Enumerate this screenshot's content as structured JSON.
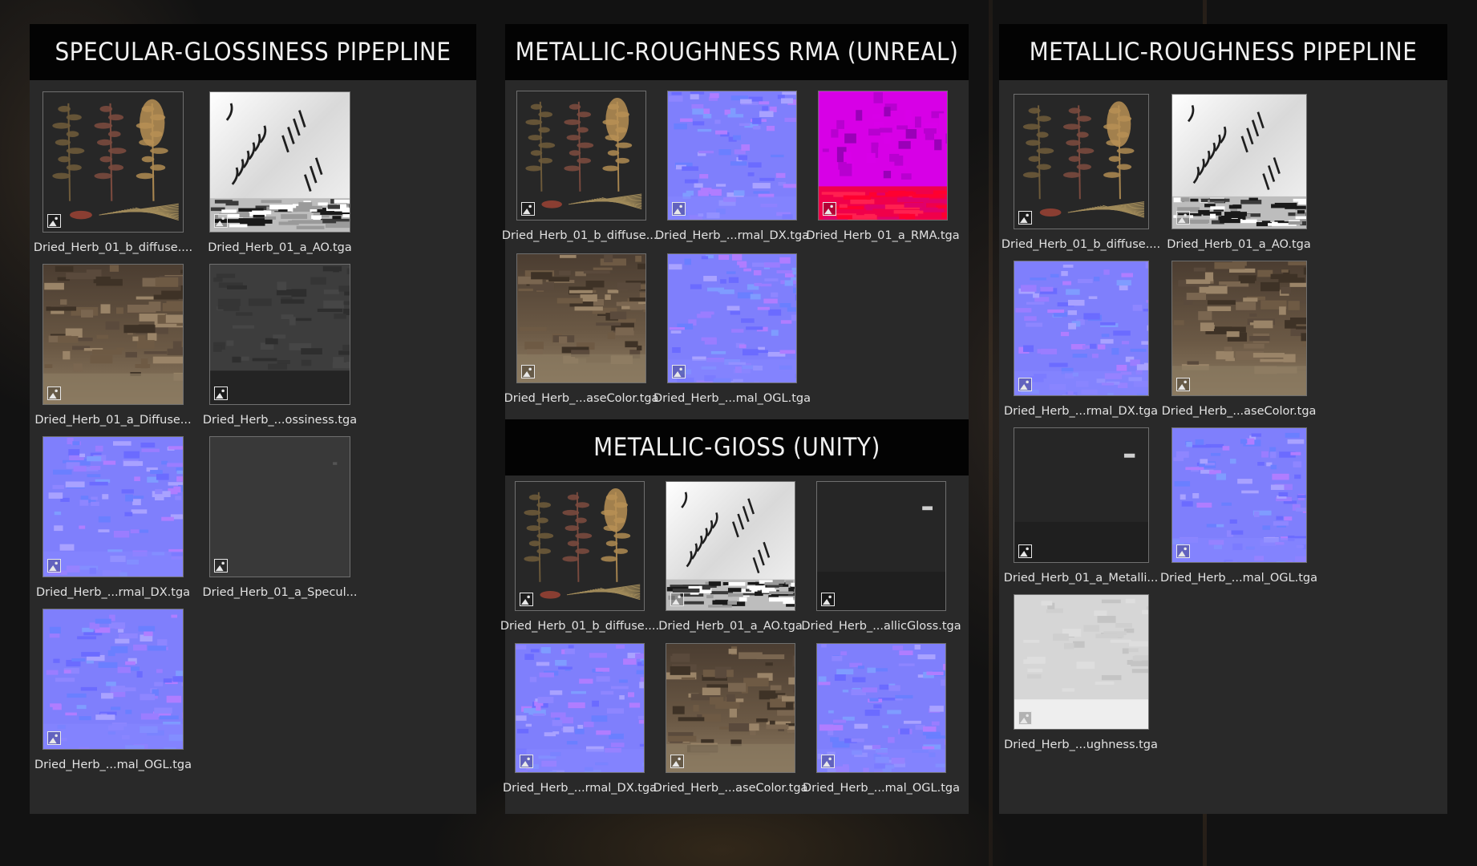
{
  "colors": {
    "panel_bg": "#292929",
    "header_bg": "#030303",
    "header_text": "#f0f0f0",
    "caption_text": "#e2e2e2"
  },
  "panels": {
    "specular_glossiness": {
      "title": "SPECULAR-GLOSSINESS PIPEPLINE",
      "items": [
        {
          "label": "Dried_Herb_01_b_diffuse....",
          "texture": "plants"
        },
        {
          "label": "Dried_Herb_01_a_AO.tga",
          "texture": "ao"
        },
        {
          "label": "Dried_Herb_01_a_Diffuse...",
          "texture": "basecolor"
        },
        {
          "label": "Dried_Herb_...ossiness.tga",
          "texture": "dark-gray"
        },
        {
          "label": "Dried_Herb_...rmal_DX.tga",
          "texture": "normal"
        },
        {
          "label": "Dried_Herb_01_a_Specul...",
          "texture": "flat-gray"
        },
        {
          "label": "Dried_Herb_...mal_OGL.tga",
          "texture": "normal"
        }
      ]
    },
    "metallic_roughness_rma": {
      "title": "METALLIC-ROUGHNESS RMA (UNREAL)",
      "items": [
        {
          "label": "Dried_Herb_01_b_diffuse....",
          "texture": "plants"
        },
        {
          "label": "Dried_Herb_...rmal_DX.tga",
          "texture": "normal"
        },
        {
          "label": "Dried_Herb_01_a_RMA.tga",
          "texture": "rma"
        },
        {
          "label": "Dried_Herb_...aseColor.tga",
          "texture": "basecolor"
        },
        {
          "label": "Dried_Herb_...mal_OGL.tga",
          "texture": "normal"
        }
      ]
    },
    "metallic_gloss_unity": {
      "title": "METALLIC-GIOSS (UNITY)",
      "items": [
        {
          "label": "Dried_Herb_01_b_diffuse....",
          "texture": "plants"
        },
        {
          "label": "Dried_Herb_01_a_AO.tga",
          "texture": "ao"
        },
        {
          "label": "Dried_Herb_...allicGloss.tga",
          "texture": "black"
        },
        {
          "label": "Dried_Herb_...rmal_DX.tga",
          "texture": "normal"
        },
        {
          "label": "Dried_Herb_...aseColor.tga",
          "texture": "basecolor"
        },
        {
          "label": "Dried_Herb_...mal_OGL.tga",
          "texture": "normal"
        }
      ]
    },
    "metallic_roughness": {
      "title": "METALLIC-ROUGHNESS PIPEPLINE",
      "items": [
        {
          "label": "Dried_Herb_01_b_diffuse....",
          "texture": "plants"
        },
        {
          "label": "Dried_Herb_01_a_AO.tga",
          "texture": "ao"
        },
        {
          "label": "Dried_Herb_...rmal_DX.tga",
          "texture": "normal"
        },
        {
          "label": "Dried_Herb_...aseColor.tga",
          "texture": "basecolor"
        },
        {
          "label": "Dried_Herb_01_a_Metalli...",
          "texture": "black"
        },
        {
          "label": "Dried_Herb_...mal_OGL.tga",
          "texture": "normal"
        },
        {
          "label": "Dried_Herb_...ughness.tga",
          "texture": "light-gray"
        }
      ]
    }
  }
}
